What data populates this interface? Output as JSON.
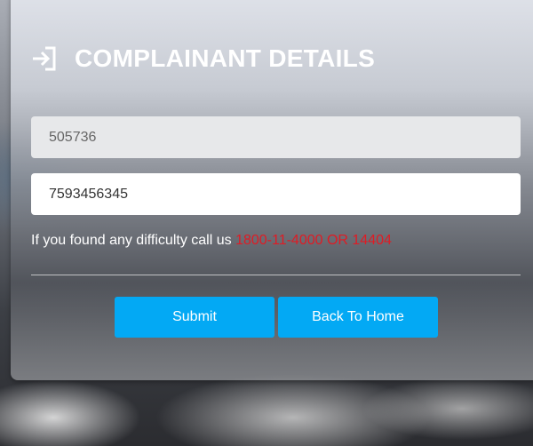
{
  "header": {
    "icon": "sign-in-icon",
    "title": "COMPLAINANT DETAILS"
  },
  "form": {
    "field1_value": "505736",
    "field2_value": "7593456345"
  },
  "help": {
    "text": "If you found any difficulty call us",
    "phone": "1800-11-4000 OR 14404"
  },
  "actions": {
    "submit_label": "Submit",
    "home_label": "Back To Home"
  },
  "colors": {
    "accent": "#03a9f4",
    "phone_text": "#e01b24"
  }
}
